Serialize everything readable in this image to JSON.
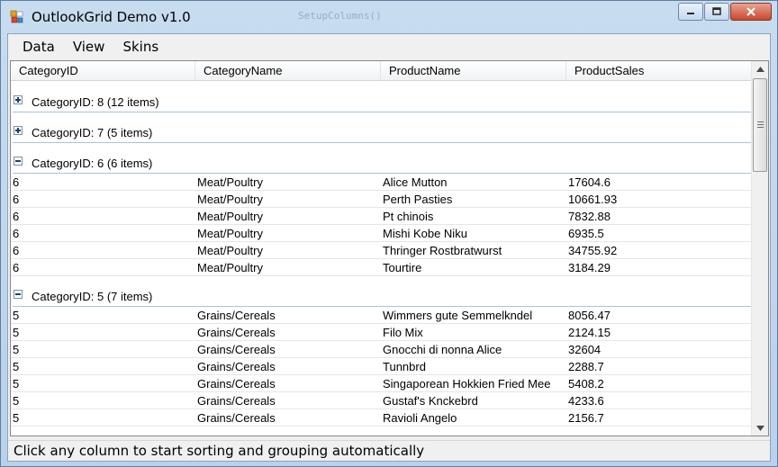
{
  "window": {
    "title": "OutlookGrid Demo v1.0",
    "ghost_title": "SetupColumns()",
    "controls": {
      "minimize_icon": "minimize-icon",
      "maximize_icon": "maximize-icon",
      "close_icon": "close-icon"
    }
  },
  "menu": [
    {
      "label": "Data"
    },
    {
      "label": "View"
    },
    {
      "label": "Skins"
    }
  ],
  "grid": {
    "columns": [
      "CategoryID",
      "CategoryName",
      "ProductName",
      "ProductSales"
    ],
    "groups": [
      {
        "label": "CategoryID: 8 (12 items)",
        "expanded": false,
        "rows": []
      },
      {
        "label": "CategoryID: 7 (5 items)",
        "expanded": false,
        "rows": []
      },
      {
        "label": "CategoryID: 6 (6 items)",
        "expanded": true,
        "rows": [
          [
            "6",
            "Meat/Poultry",
            "Alice Mutton",
            "17604.6"
          ],
          [
            "6",
            "Meat/Poultry",
            "Perth Pasties",
            "10661.93"
          ],
          [
            "6",
            "Meat/Poultry",
            "Pt chinois",
            "7832.88"
          ],
          [
            "6",
            "Meat/Poultry",
            "Mishi Kobe Niku",
            "6935.5"
          ],
          [
            "6",
            "Meat/Poultry",
            "Thringer Rostbratwurst",
            "34755.92"
          ],
          [
            "6",
            "Meat/Poultry",
            "Tourtire",
            "3184.29"
          ]
        ]
      },
      {
        "label": "CategoryID: 5 (7 items)",
        "expanded": true,
        "rows": [
          [
            "5",
            "Grains/Cereals",
            "Wimmers gute Semmelkndel",
            "8056.47"
          ],
          [
            "5",
            "Grains/Cereals",
            "Filo Mix",
            "2124.15"
          ],
          [
            "5",
            "Grains/Cereals",
            "Gnocchi di nonna Alice",
            "32604"
          ],
          [
            "5",
            "Grains/Cereals",
            "Tunnbrd",
            "2288.7"
          ],
          [
            "5",
            "Grains/Cereals",
            "Singaporean Hokkien Fried Mee",
            "5408.2"
          ],
          [
            "5",
            "Grains/Cereals",
            "Gustaf's Knckebrd",
            "4233.6"
          ],
          [
            "5",
            "Grains/Cereals",
            "Ravioli Angelo",
            "2156.7"
          ]
        ]
      }
    ]
  },
  "status": {
    "text": "Click any column to start sorting and grouping automatically"
  }
}
